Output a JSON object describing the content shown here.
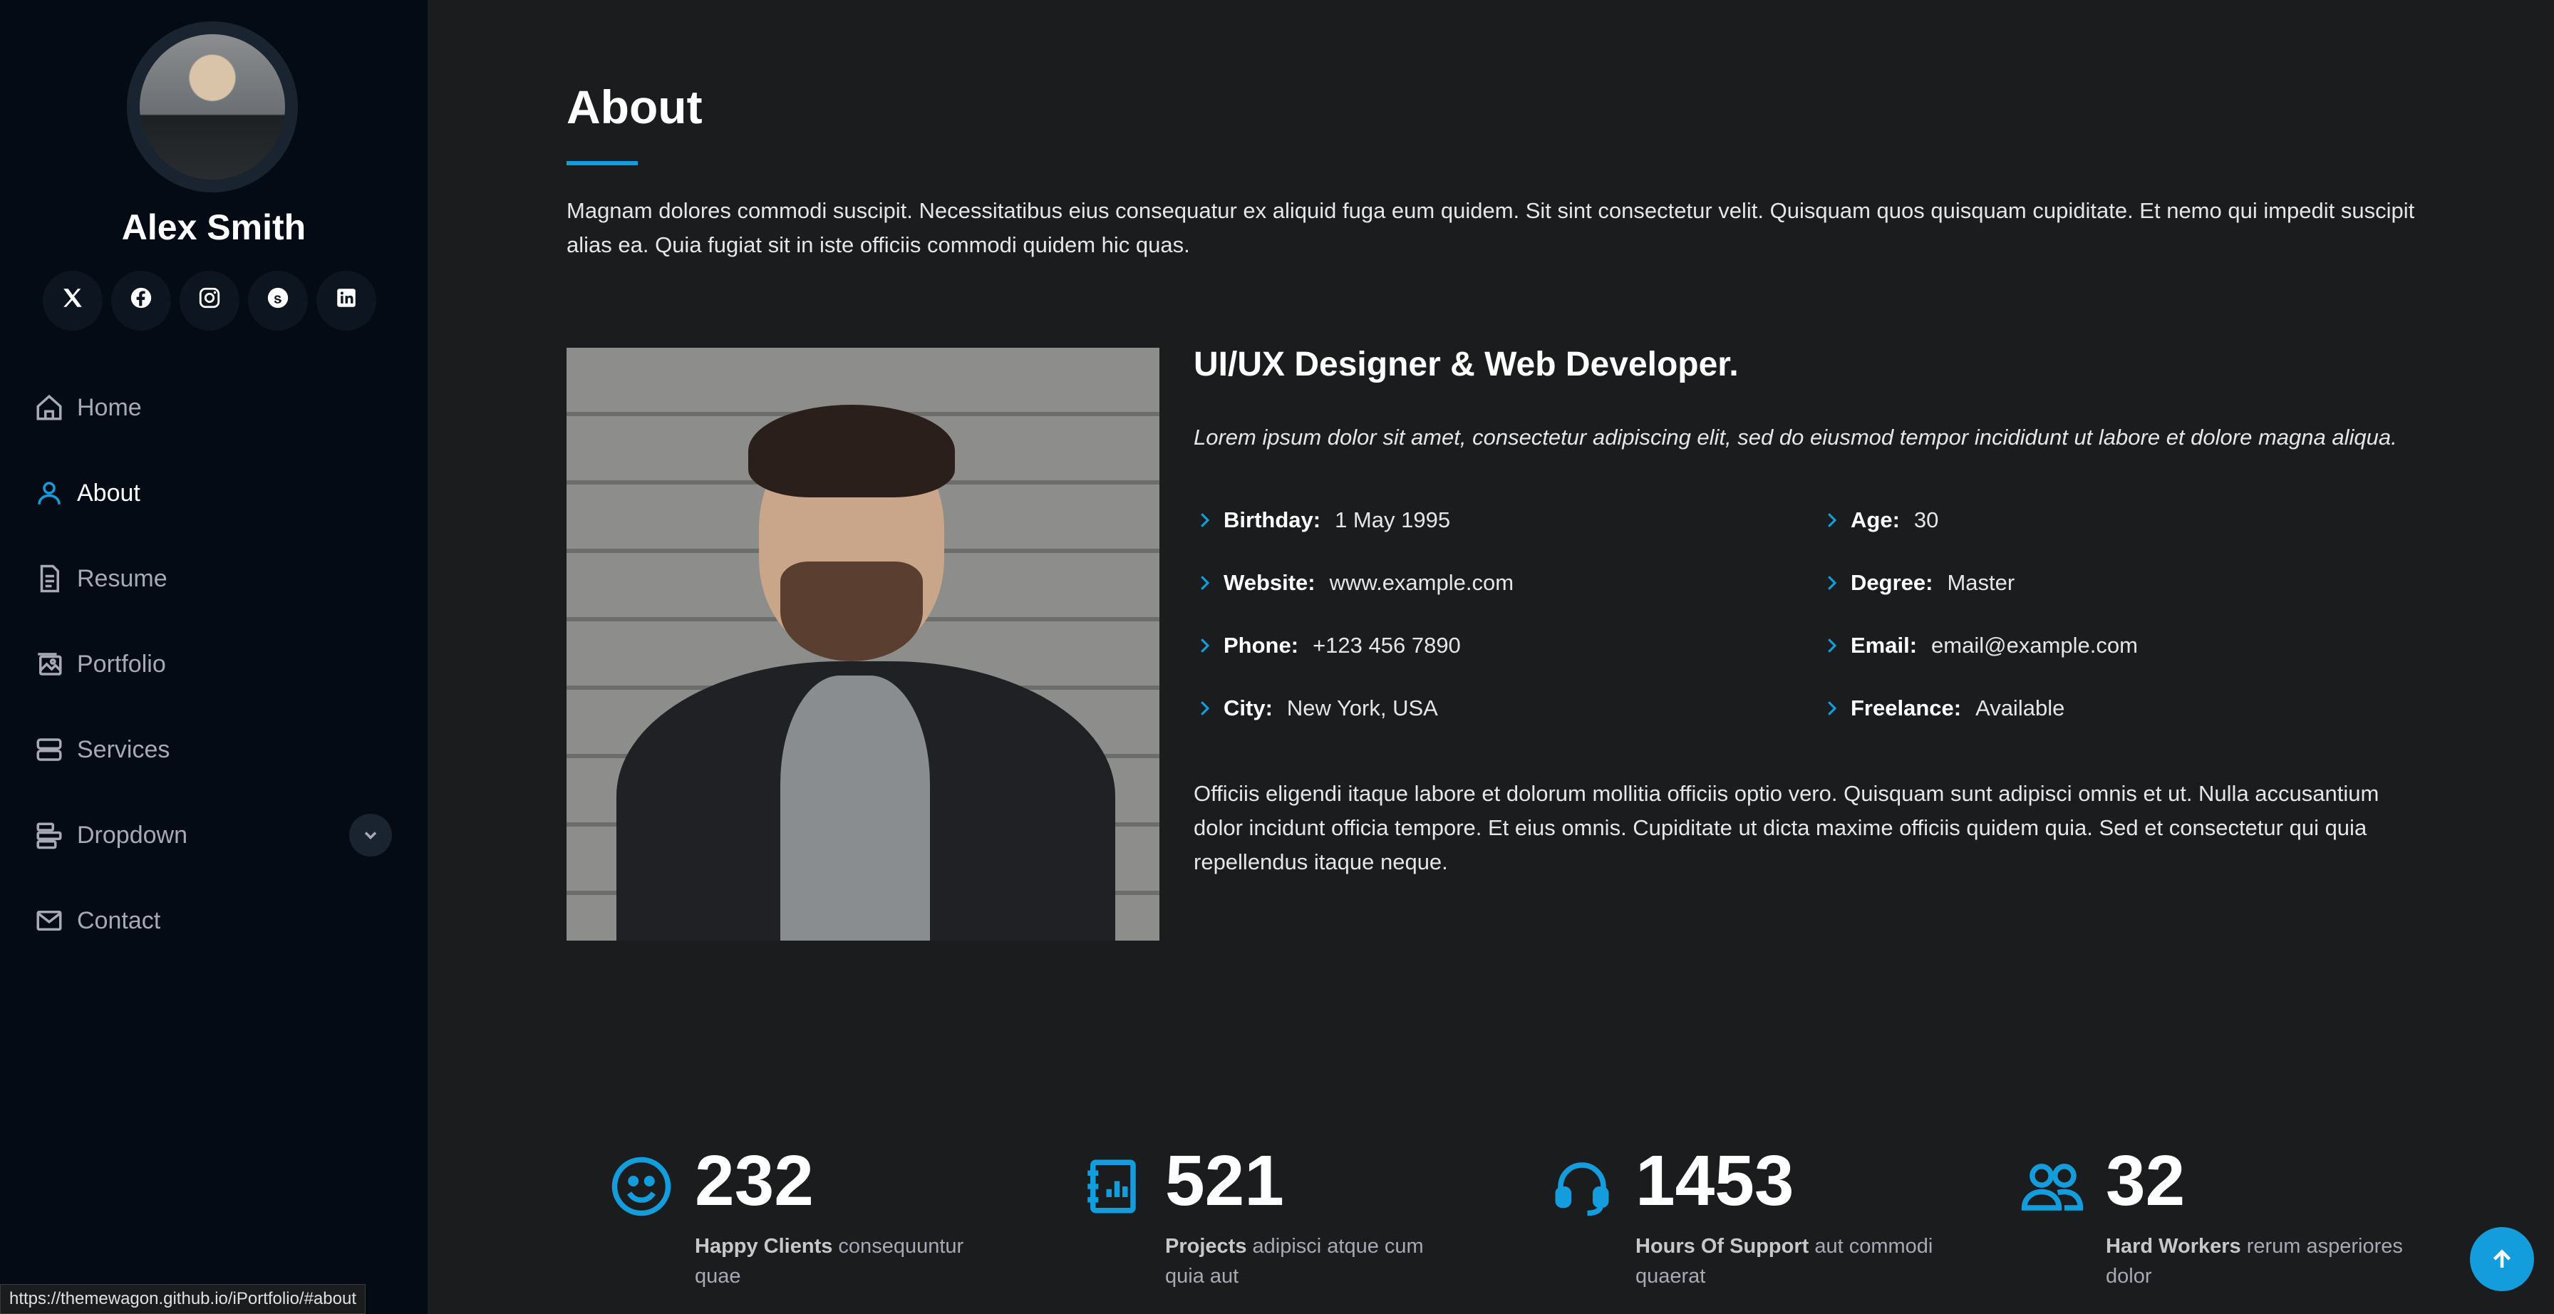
{
  "profile": {
    "name": "Alex Smith",
    "socials": [
      {
        "icon": "x-icon"
      },
      {
        "icon": "facebook-icon"
      },
      {
        "icon": "instagram-icon"
      },
      {
        "icon": "skype-icon"
      },
      {
        "icon": "linkedin-icon"
      }
    ]
  },
  "nav": {
    "items": [
      {
        "label": "Home",
        "icon": "house-icon"
      },
      {
        "label": "About",
        "icon": "person-icon",
        "active": true
      },
      {
        "label": "Resume",
        "icon": "file-text-icon"
      },
      {
        "label": "Portfolio",
        "icon": "images-icon"
      },
      {
        "label": "Services",
        "icon": "hdd-stack-icon"
      },
      {
        "label": "Dropdown",
        "icon": "menu-icon"
      },
      {
        "label": "Contact",
        "icon": "envelope-icon"
      }
    ]
  },
  "about": {
    "title": "About",
    "intro": "Magnam dolores commodi suscipit. Necessitatibus eius consequatur ex aliquid fuga eum quidem. Sit sint consectetur velit. Quisquam quos quisquam cupiditate. Et nemo qui impedit suscipit alias ea. Quia fugiat sit in iste officiis commodi quidem hic quas.",
    "role": "UI/UX Designer & Web Developer.",
    "tagline": "Lorem ipsum dolor sit amet, consectetur adipiscing elit, sed do eiusmod tempor incididunt ut labore et dolore magna aliqua.",
    "facts": [
      {
        "key": "Birthday:",
        "value": "1 May 1995"
      },
      {
        "key": "Age:",
        "value": "30"
      },
      {
        "key": "Website:",
        "value": "www.example.com"
      },
      {
        "key": "Degree:",
        "value": "Master"
      },
      {
        "key": "Phone:",
        "value": "+123 456 7890"
      },
      {
        "key": "Email:",
        "value": "email@example.com"
      },
      {
        "key": "City:",
        "value": "New York, USA"
      },
      {
        "key": "Freelance:",
        "value": "Available"
      }
    ],
    "outro": "Officiis eligendi itaque labore et dolorum mollitia officiis optio vero. Quisquam sunt adipisci omnis et ut. Nulla accusantium dolor incidunt officia tempore. Et eius omnis. Cupiditate ut dicta maxime officiis quidem quia. Sed et consectetur qui quia repellendus itaque neque."
  },
  "stats": [
    {
      "icon": "emoji-smile-icon",
      "number": "232",
      "label": "Happy Clients",
      "text": " consequuntur quae"
    },
    {
      "icon": "journal-icon",
      "number": "521",
      "label": "Projects",
      "text": " adipisci atque cum quia aut"
    },
    {
      "icon": "headset-icon",
      "number": "1453",
      "label": "Hours Of Support",
      "text": " aut commodi quaerat"
    },
    {
      "icon": "people-icon",
      "number": "32",
      "label": "Hard Workers",
      "text": " rerum asperiores dolor"
    }
  ],
  "status_url": "https://themewagon.github.io/iPortfolio/#about",
  "colors": {
    "accent": "#149ddd",
    "sidebar": "#040b14",
    "background": "#1b1c1e"
  }
}
